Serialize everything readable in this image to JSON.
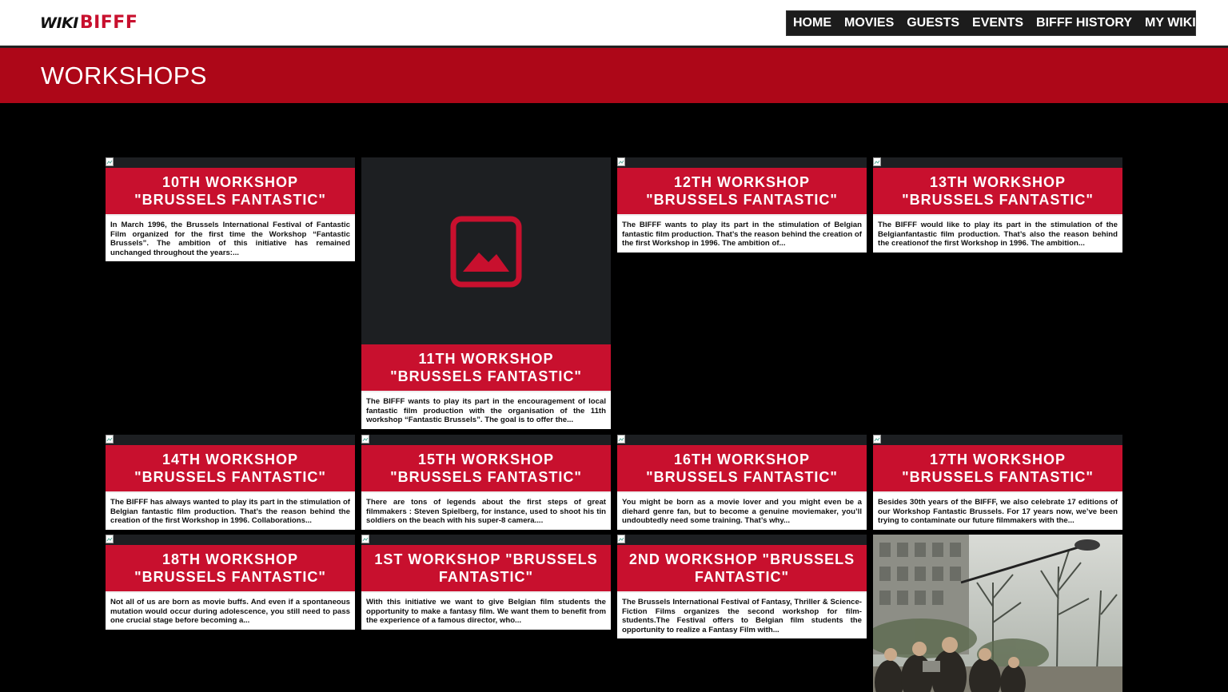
{
  "logo": {
    "part1": "WIKI",
    "part2": "BIFFF"
  },
  "nav": {
    "items": [
      "HOME",
      "MOVIES",
      "GUESTS",
      "EVENTS",
      "BIFFF HISTORY",
      "MY WIKI"
    ],
    "dropdown_icon": "caret-down-icon"
  },
  "banner": {
    "title": "WORKSHOPS"
  },
  "colors": {
    "brand_red": "#c8102e",
    "banner_red": "#ad0718",
    "background": "#000000"
  },
  "cards": [
    {
      "title": "10TH WORKSHOP \"BRUSSELS FANTASTIC\"",
      "excerpt": "In March 1996, the Brussels International Festival of Fantastic Film organized for the first time the Workshop “Fantastic Brussels”. The ambition of this initiative has remained unchanged throughout the years:..."
    },
    {
      "title": "11TH WORKSHOP \"BRUSSELS FANTASTIC\"",
      "excerpt": "The BIFFF wants to play its part in the encouragement of local fantastic film production with the organisation of the 11th workshop “Fantastic Brussels”. The goal is to offer the..."
    },
    {
      "title": "12TH WORKSHOP \"BRUSSELS FANTASTIC\"",
      "excerpt": "The BIFFF wants to play its part in the stimulation of Belgian fantastic film production. That’s the reason behind the creation of the first Workshop in 1996. The ambition of..."
    },
    {
      "title": "13TH WORKSHOP \"BRUSSELS FANTASTIC\"",
      "excerpt": "The BIFFF would like to play its part in the stimulation of the Belgianfantastic film production. That’s also the reason behind the creationof the first Workshop in 1996. The ambition..."
    },
    {
      "title": "14TH WORKSHOP \"BRUSSELS FANTASTIC\"",
      "excerpt": "The BIFFF has always wanted to play its part in the stimulation of Belgian fantastic film production. That’s the reason behind the creation of the first Workshop in 1996. Collaborations..."
    },
    {
      "title": "15TH WORKSHOP \"BRUSSELS FANTASTIC\"",
      "excerpt": "There are tons of legends about the first steps of great filmmakers : Steven Spielberg, for instance, used to shoot his tin soldiers on the beach with his super-8 camera...."
    },
    {
      "title": "16TH WORKSHOP \"BRUSSELS FANTASTIC\"",
      "excerpt": "You might be born as a movie lover and you might even be a diehard genre fan, but to become a genuine moviemaker, you’ll undoubtedly need some training. That’s why..."
    },
    {
      "title": "17TH WORKSHOP \"BRUSSELS FANTASTIC\"",
      "excerpt": "Besides 30th years of the BIFFF, we also celebrate 17 editions of our Workshop Fantastic Brussels. For 17 years now, we’ve been trying to contaminate our future filmmakers with the..."
    },
    {
      "title": "18TH WORKSHOP \"BRUSSELS FANTASTIC\"",
      "excerpt": "Not all of us are born as movie buffs. And even if a spontaneous mutation would occur during adolescence, you still need to pass one crucial stage before becoming a..."
    },
    {
      "title": "1ST WORKSHOP \"BRUSSELS FANTASTIC\"",
      "excerpt": "With this initiative we want to give Belgian film students the opportunity to make a fantasy film. We want them to benefit from the experience of a famous director, who..."
    },
    {
      "title": "2ND WORKSHOP \"BRUSSELS FANTASTIC\"",
      "excerpt": "The Brussels International Festival of Fantasy, Thriller & Science-Fiction Films organizes the second workshop for film-students.The Festival offers to Belgian film students the opportunity to realize a Fantasy Film with..."
    }
  ],
  "icons": {
    "placeholder": "image-placeholder-icon",
    "broken_image": "broken-image-icon"
  }
}
